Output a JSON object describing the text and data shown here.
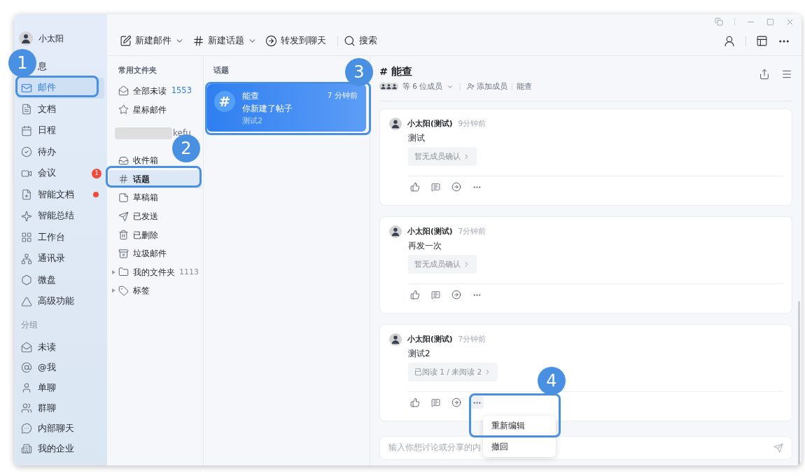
{
  "user": {
    "name": "小太阳"
  },
  "nav": [
    {
      "label": "息",
      "unread_dot": false,
      "selected": false
    },
    {
      "label": "邮件",
      "unread_dot": false,
      "selected": true
    },
    {
      "label": "文档",
      "unread_dot": false,
      "selected": false
    },
    {
      "label": "日程",
      "unread_dot": false,
      "selected": false
    },
    {
      "label": "待办",
      "unread_dot": false,
      "selected": false
    },
    {
      "label": "会议",
      "badge": "1",
      "unread_dot": false,
      "selected": false
    },
    {
      "label": "智能文档",
      "unread_dot": true,
      "selected": false
    },
    {
      "label": "智能总结",
      "unread_dot": false,
      "selected": false
    },
    {
      "label": "工作台",
      "unread_dot": false,
      "selected": false
    },
    {
      "label": "通讯录",
      "unread_dot": false,
      "selected": false
    },
    {
      "label": "微盘",
      "unread_dot": false,
      "selected": false
    },
    {
      "label": "高级功能",
      "unread_dot": false,
      "selected": false
    }
  ],
  "groups_heading": "分组",
  "groups": [
    {
      "label": "未读"
    },
    {
      "label": "@我"
    },
    {
      "label": "单聊"
    },
    {
      "label": "群聊"
    },
    {
      "label": "内部聊天"
    }
  ],
  "footer": {
    "label": "我的企业"
  },
  "toolbar": [
    {
      "label": "新建邮件",
      "dropdown": true
    },
    {
      "label": "新建话题",
      "dropdown": true
    },
    {
      "label": "转发到聊天",
      "dropdown": false
    },
    {
      "label": "搜索",
      "dropdown": false
    }
  ],
  "folders": {
    "heading": "常用文件夹",
    "favorites": [
      {
        "label": "全部未读",
        "count": "1553"
      },
      {
        "label": "星标邮件"
      }
    ],
    "account": "kefu",
    "items": [
      {
        "label": "收件箱",
        "selected": false,
        "expandable": false
      },
      {
        "label": "话题",
        "selected": true,
        "expandable": false
      },
      {
        "label": "草稿箱",
        "selected": false,
        "expandable": false
      },
      {
        "label": "已发送",
        "selected": false,
        "expandable": false
      },
      {
        "label": "已删除",
        "selected": false,
        "expandable": false
      },
      {
        "label": "垃圾邮件",
        "selected": false,
        "expandable": false
      },
      {
        "label": "我的文件夹",
        "count": "1113",
        "selected": false,
        "expandable": true
      },
      {
        "label": "标签",
        "selected": false,
        "expandable": true
      }
    ]
  },
  "topics": {
    "heading": "话题",
    "items": [
      {
        "avatar_text": "#",
        "title": "能查",
        "time": "7 分钟前",
        "summary": "你新建了帖子",
        "preview": "测试2",
        "selected": true
      }
    ]
  },
  "thread": {
    "title": "# 能查",
    "members": "等 6 位成员",
    "add_member": "添加成员",
    "tag": "能查"
  },
  "messages": [
    {
      "author": "小太阳(测试)",
      "time": "9分钟前",
      "text": "测试",
      "receipt": "暂无成员确认",
      "menu_open": false
    },
    {
      "author": "小太阳(测试)",
      "time": "7分钟前",
      "text": "再发一次",
      "receipt": "暂无成员确认",
      "menu_open": false
    },
    {
      "author": "小太阳(测试)",
      "time": "7分钟前",
      "text": "测试2",
      "receipt": "已阅读 1 / 未阅读 2",
      "menu_open": true
    }
  ],
  "menu": {
    "items": [
      {
        "label": "重新编辑"
      },
      {
        "label": "撤回"
      }
    ]
  },
  "composer": {
    "placeholder": "输入你想讨论或分享的内"
  },
  "callouts": [
    {
      "number": "1"
    },
    {
      "number": "2"
    },
    {
      "number": "3"
    },
    {
      "number": "4"
    }
  ]
}
